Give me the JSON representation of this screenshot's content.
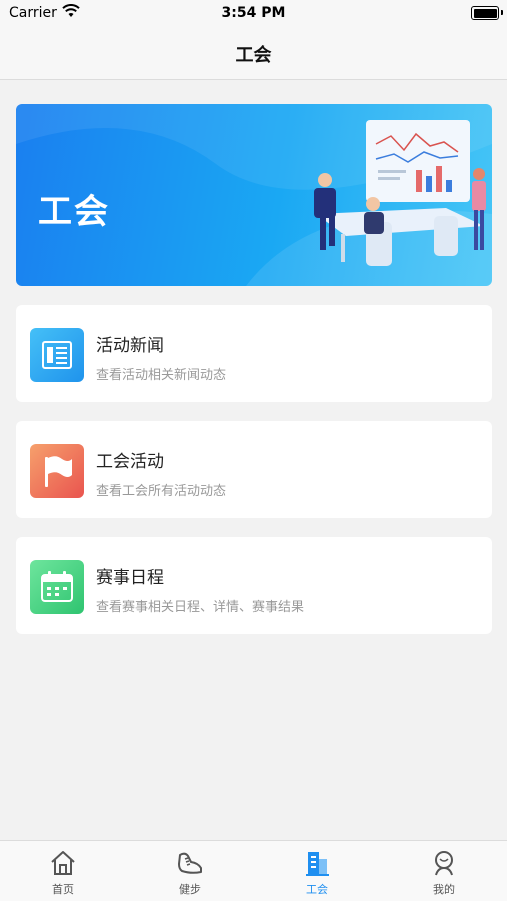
{
  "status_bar": {
    "carrier": "Carrier",
    "time": "3:54 PM"
  },
  "nav": {
    "title": "工会"
  },
  "banner": {
    "title": "工会"
  },
  "cards": [
    {
      "title": "活动新闻",
      "subtitle": "查看活动相关新闻动态",
      "icon": "news-icon",
      "color": "#2aa8f0"
    },
    {
      "title": "工会活动",
      "subtitle": "查看工会所有活动动态",
      "icon": "flag-icon",
      "color": "#ef6d5b"
    },
    {
      "title": "赛事日程",
      "subtitle": "查看赛事相关日程、详情、赛事结果",
      "icon": "calendar-icon",
      "color": "#3ed27e"
    }
  ],
  "tabs": [
    {
      "label": "首页",
      "icon": "home-icon"
    },
    {
      "label": "健步",
      "icon": "shoe-icon"
    },
    {
      "label": "工会",
      "icon": "building-icon",
      "active": true
    },
    {
      "label": "我的",
      "icon": "profile-icon"
    }
  ],
  "colors": {
    "accent": "#1f8ff0",
    "background": "#f2f2f2"
  }
}
